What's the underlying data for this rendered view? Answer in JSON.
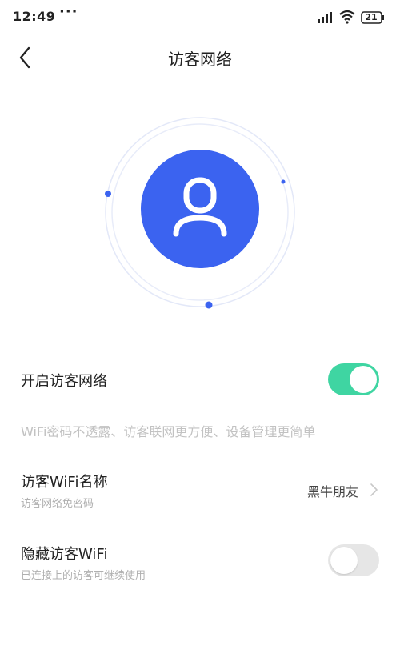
{
  "status_bar": {
    "time": "12:49",
    "dots": "···",
    "battery_level": "21",
    "signal_icon": "signal-icon",
    "wifi_icon": "wifi-icon",
    "battery_icon": "battery-icon"
  },
  "nav": {
    "back_icon": "chevron-left-icon",
    "title": "访客网络"
  },
  "hero": {
    "icon": "user-avatar-icon",
    "accent_color": "#3b63f0"
  },
  "settings": {
    "guest_network": {
      "label": "开启访客网络",
      "enabled": true,
      "toggle_color": "#3fd5a2"
    },
    "hint": "WiFi密码不透露、访客联网更方便、设备管理更简单",
    "guest_wifi_name": {
      "label": "访客WiFi名称",
      "sublabel": "访客网络免密码",
      "value": "黑牛朋友"
    },
    "hide_guest_wifi": {
      "label": "隐藏访客WiFi",
      "sublabel": "已连接上的访客可继续使用",
      "enabled": false
    }
  }
}
